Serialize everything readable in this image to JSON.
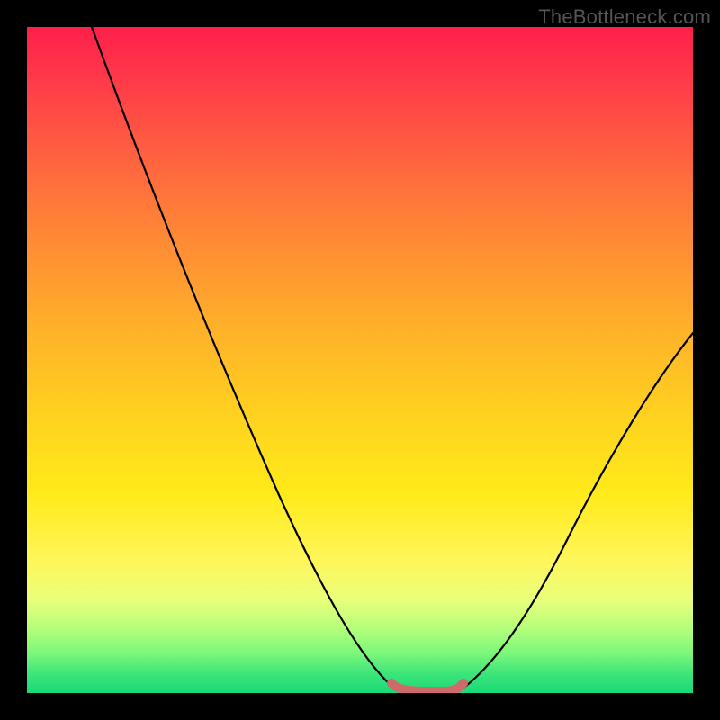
{
  "watermark": "TheBottleneck.com",
  "chart_data": {
    "type": "line",
    "title": "",
    "xlabel": "",
    "ylabel": "",
    "xlim": [
      0,
      100
    ],
    "ylim": [
      0,
      100
    ],
    "series": [
      {
        "name": "left-curve",
        "x": [
          10,
          15,
          20,
          25,
          30,
          35,
          40,
          45,
          50,
          52,
          54,
          56
        ],
        "y": [
          100,
          86,
          72,
          59,
          46,
          34,
          24,
          14,
          6,
          3,
          1,
          0
        ]
      },
      {
        "name": "right-curve",
        "x": [
          64,
          66,
          68,
          72,
          76,
          80,
          84,
          88,
          92,
          96,
          100
        ],
        "y": [
          0,
          1,
          3,
          7,
          12,
          18,
          24,
          31,
          38,
          46,
          54
        ]
      },
      {
        "name": "optimal-zone-marker",
        "x": [
          55,
          56,
          57,
          58,
          59,
          60,
          61,
          62,
          63,
          64,
          65
        ],
        "y": [
          1.2,
          0.8,
          0.6,
          0.5,
          0.5,
          0.5,
          0.5,
          0.5,
          0.6,
          0.8,
          1.2
        ]
      }
    ],
    "colors": {
      "curve": "#000000",
      "marker": "#cf6a6a",
      "gradient_top": "#ff1f4a",
      "gradient_bottom": "#18d978"
    }
  }
}
